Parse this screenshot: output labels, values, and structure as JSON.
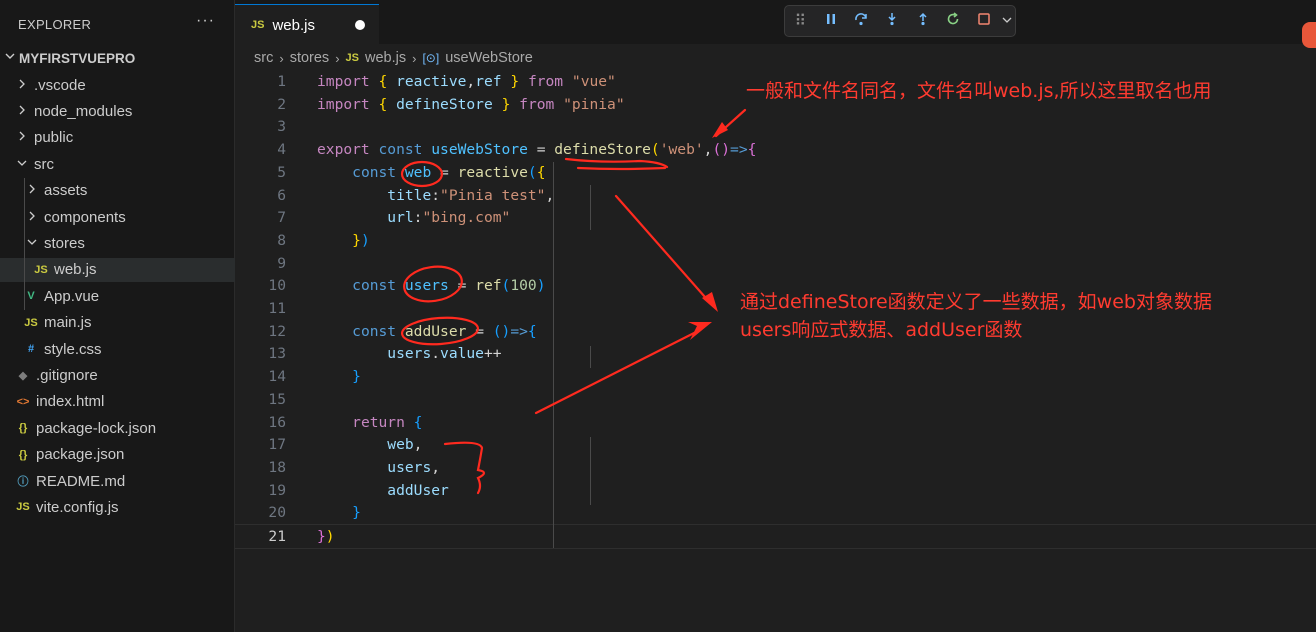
{
  "sidebar": {
    "title": "EXPLORER",
    "more": "···",
    "root": "MYFIRSTVUEPRO",
    "items": [
      {
        "label": ".vscode",
        "kind": "folder",
        "expanded": false,
        "depth": 1
      },
      {
        "label": "node_modules",
        "kind": "folder",
        "expanded": false,
        "depth": 1
      },
      {
        "label": "public",
        "kind": "folder",
        "expanded": false,
        "depth": 1
      },
      {
        "label": "src",
        "kind": "folder",
        "expanded": true,
        "depth": 1
      },
      {
        "label": "assets",
        "kind": "folder",
        "expanded": false,
        "depth": 2
      },
      {
        "label": "components",
        "kind": "folder",
        "expanded": false,
        "depth": 2
      },
      {
        "label": "stores",
        "kind": "folder",
        "expanded": true,
        "depth": 2
      },
      {
        "label": "web.js",
        "kind": "js",
        "depth": 3,
        "selected": true
      },
      {
        "label": "App.vue",
        "kind": "vue",
        "depth": 2
      },
      {
        "label": "main.js",
        "kind": "js",
        "depth": 2
      },
      {
        "label": "style.css",
        "kind": "css",
        "depth": 2
      },
      {
        "label": ".gitignore",
        "kind": "git",
        "depth": 1
      },
      {
        "label": "index.html",
        "kind": "html",
        "depth": 1
      },
      {
        "label": "package-lock.json",
        "kind": "json",
        "depth": 1
      },
      {
        "label": "package.json",
        "kind": "json",
        "depth": 1
      },
      {
        "label": "README.md",
        "kind": "info",
        "depth": 1
      },
      {
        "label": "vite.config.js",
        "kind": "js",
        "depth": 1
      }
    ]
  },
  "tab": {
    "badge": "JS",
    "name": "web.js"
  },
  "breadcrumb": {
    "p1": "src",
    "p2": "stores",
    "badge": "JS",
    "p3": "web.js",
    "p4": "useWebStore"
  },
  "icons": {
    "chevron_right": "chevron-right-icon",
    "chevron_down": "chevron-down-icon",
    "debug": [
      "grip-icon",
      "pause-icon",
      "step-over-icon",
      "step-into-icon",
      "step-out-icon",
      "restart-icon",
      "stop-icon"
    ]
  },
  "code": [
    {
      "n": "1",
      "t": [
        [
          "kp",
          "import"
        ],
        [
          "p",
          " "
        ],
        [
          "b1",
          "{"
        ],
        [
          "p",
          " "
        ],
        [
          "v",
          "reactive"
        ],
        [
          "p",
          ","
        ],
        [
          "v",
          "ref"
        ],
        [
          "p",
          " "
        ],
        [
          "b1",
          "}"
        ],
        [
          "p",
          " "
        ],
        [
          "kp",
          "from"
        ],
        [
          "p",
          " "
        ],
        [
          "s",
          "\"vue\""
        ]
      ]
    },
    {
      "n": "2",
      "t": [
        [
          "kp",
          "import"
        ],
        [
          "p",
          " "
        ],
        [
          "b1",
          "{"
        ],
        [
          "p",
          " "
        ],
        [
          "v",
          "defineStore"
        ],
        [
          "p",
          " "
        ],
        [
          "b1",
          "}"
        ],
        [
          "p",
          " "
        ],
        [
          "kp",
          "from"
        ],
        [
          "p",
          " "
        ],
        [
          "s",
          "\"pinia\""
        ]
      ]
    },
    {
      "n": "3",
      "t": []
    },
    {
      "n": "4",
      "t": [
        [
          "kp",
          "export"
        ],
        [
          "p",
          " "
        ],
        [
          "k",
          "const"
        ],
        [
          "p",
          " "
        ],
        [
          "cst",
          "useWebStore"
        ],
        [
          "p",
          " = "
        ],
        [
          "f",
          "defineStore"
        ],
        [
          "b1",
          "("
        ],
        [
          "s",
          "'web'"
        ],
        [
          "p",
          ","
        ],
        [
          "b2",
          "()"
        ],
        [
          "k",
          "=>"
        ],
        [
          "b2",
          "{"
        ]
      ]
    },
    {
      "n": "5",
      "t": [
        [
          "p",
          "    "
        ],
        [
          "k",
          "const"
        ],
        [
          "p",
          " "
        ],
        [
          "cst",
          "web"
        ],
        [
          "p",
          " = "
        ],
        [
          "f",
          "reactive"
        ],
        [
          "b3",
          "("
        ],
        [
          "b1",
          "{"
        ]
      ]
    },
    {
      "n": "6",
      "t": [
        [
          "p",
          "        "
        ],
        [
          "v",
          "title"
        ],
        [
          "p",
          ":"
        ],
        [
          "s",
          "\"Pinia test\""
        ],
        [
          "p",
          ","
        ]
      ]
    },
    {
      "n": "7",
      "t": [
        [
          "p",
          "        "
        ],
        [
          "v",
          "url"
        ],
        [
          "p",
          ":"
        ],
        [
          "s",
          "\"bing.com\""
        ]
      ]
    },
    {
      "n": "8",
      "t": [
        [
          "p",
          "    "
        ],
        [
          "b1",
          "}"
        ],
        [
          "b3",
          ")"
        ]
      ]
    },
    {
      "n": "9",
      "t": []
    },
    {
      "n": "10",
      "t": [
        [
          "p",
          "    "
        ],
        [
          "k",
          "const"
        ],
        [
          "p",
          " "
        ],
        [
          "cst",
          "users"
        ],
        [
          "p",
          " = "
        ],
        [
          "f",
          "ref"
        ],
        [
          "b3",
          "("
        ],
        [
          "n",
          "100"
        ],
        [
          "b3",
          ")"
        ]
      ]
    },
    {
      "n": "11",
      "t": []
    },
    {
      "n": "12",
      "t": [
        [
          "p",
          "    "
        ],
        [
          "k",
          "const"
        ],
        [
          "p",
          " "
        ],
        [
          "f",
          "addUser"
        ],
        [
          "p",
          " = "
        ],
        [
          "b3",
          "()"
        ],
        [
          "k",
          "=>"
        ],
        [
          "b3",
          "{"
        ]
      ]
    },
    {
      "n": "13",
      "t": [
        [
          "p",
          "        "
        ],
        [
          "v",
          "users"
        ],
        [
          "p",
          "."
        ],
        [
          "v",
          "value"
        ],
        [
          "p",
          "++"
        ]
      ]
    },
    {
      "n": "14",
      "t": [
        [
          "p",
          "    "
        ],
        [
          "b3",
          "}"
        ]
      ]
    },
    {
      "n": "15",
      "t": []
    },
    {
      "n": "16",
      "t": [
        [
          "p",
          "    "
        ],
        [
          "kp",
          "return"
        ],
        [
          "p",
          " "
        ],
        [
          "b3",
          "{"
        ]
      ]
    },
    {
      "n": "17",
      "t": [
        [
          "p",
          "        "
        ],
        [
          "v",
          "web"
        ],
        [
          "p",
          ","
        ]
      ]
    },
    {
      "n": "18",
      "t": [
        [
          "p",
          "        "
        ],
        [
          "v",
          "users"
        ],
        [
          "p",
          ","
        ]
      ]
    },
    {
      "n": "19",
      "t": [
        [
          "p",
          "        "
        ],
        [
          "v",
          "addUser"
        ]
      ]
    },
    {
      "n": "20",
      "t": [
        [
          "p",
          "    "
        ],
        [
          "b3",
          "}"
        ]
      ]
    },
    {
      "n": "21",
      "t": [
        [
          "b2",
          "}"
        ],
        [
          "b1",
          ")"
        ]
      ]
    }
  ],
  "annotations": {
    "a1": "一般和文件名同名，文件名叫web.js,所以这里取名也用",
    "a2_line1": "通过defineStore函数定义了一些数据，如web对象数据",
    "a2_line2": "users响应式数据、addUser函数"
  },
  "colors": {
    "annotation": "#ff3b30",
    "accent": "#0078d4"
  }
}
